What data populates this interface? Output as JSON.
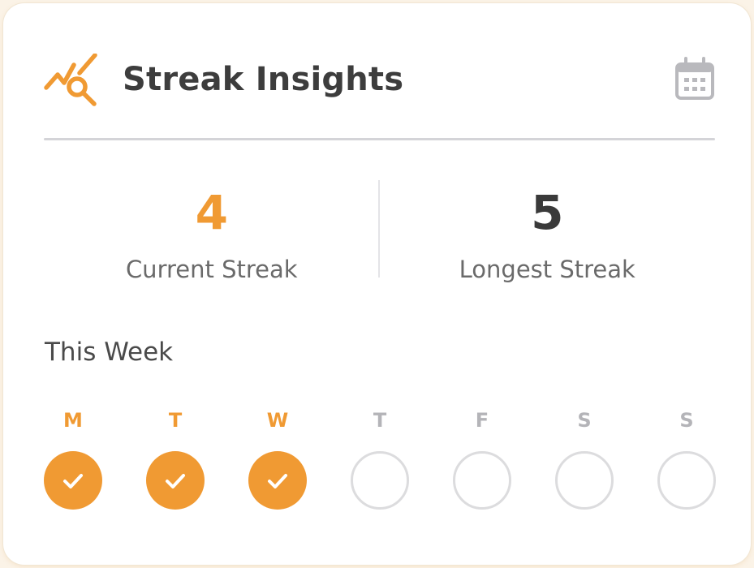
{
  "header": {
    "title": "Streak Insights",
    "icon": "streak-insights-icon",
    "action_icon": "calendar-icon"
  },
  "stats": {
    "current": {
      "value": "4",
      "label": "Current Streak"
    },
    "longest": {
      "value": "5",
      "label": "Longest Streak"
    }
  },
  "week": {
    "title": "This Week",
    "days": [
      {
        "letter": "M",
        "completed": true
      },
      {
        "letter": "T",
        "completed": true
      },
      {
        "letter": "W",
        "completed": true
      },
      {
        "letter": "T",
        "completed": false
      },
      {
        "letter": "F",
        "completed": false
      },
      {
        "letter": "S",
        "completed": false
      },
      {
        "letter": "S",
        "completed": false
      }
    ]
  },
  "colors": {
    "accent": "#f09a33",
    "text_dark": "#3d3d3d",
    "muted": "#b4b4b8",
    "divider": "#d4d4d8"
  }
}
